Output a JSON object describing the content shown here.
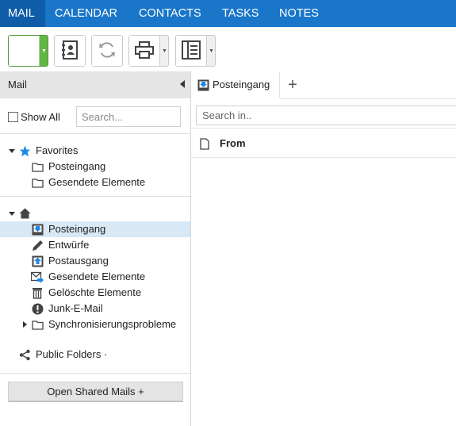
{
  "nav": {
    "items": [
      {
        "label": "MAIL",
        "active": true
      },
      {
        "label": "CALENDAR",
        "active": false
      },
      {
        "label": "CONTACTS",
        "active": false
      },
      {
        "label": "TASKS",
        "active": false
      },
      {
        "label": "NOTES",
        "active": false
      }
    ]
  },
  "toolbar": {
    "buttons": [
      "new-mail-icon",
      "address-book-icon",
      "sync-icon",
      "printer-icon",
      "view-layout-icon"
    ]
  },
  "sidebar": {
    "title": "Mail",
    "show_all_label": "Show All",
    "search_placeholder": "Search...",
    "favorites": {
      "label": "Favorites",
      "items": [
        "Posteingang",
        "Gesendete Elemente"
      ]
    },
    "mailbox": {
      "items": [
        {
          "label": "Posteingang",
          "icon": "inbox-icon",
          "selected": true
        },
        {
          "label": "Entwürfe",
          "icon": "pencil-icon"
        },
        {
          "label": "Postausgang",
          "icon": "outbox-icon"
        },
        {
          "label": "Gesendete Elemente",
          "icon": "sent-icon"
        },
        {
          "label": "Gelöschte Elemente",
          "icon": "trash-icon"
        },
        {
          "label": "Junk-E-Mail",
          "icon": "junk-icon"
        },
        {
          "label": "Synchronisierungsprobleme",
          "icon": "folder-icon"
        }
      ]
    },
    "public_folders_label": "Public Folders ·",
    "open_shared_label": "Open Shared Mails +"
  },
  "main": {
    "tab_label": "Posteingang",
    "tab_add": "+",
    "search_placeholder": "Search in..",
    "column_from": "From"
  },
  "colors": {
    "nav_bg": "#1976c9",
    "nav_active": "#0f5ca8",
    "accent_green": "#63b644",
    "selected_row": "#d8e8f4",
    "icon_blue": "#1e88e5"
  }
}
